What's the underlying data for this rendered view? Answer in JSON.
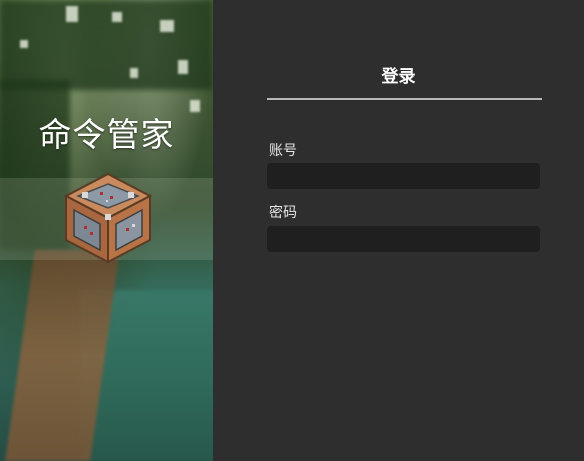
{
  "app": {
    "title": "命令管家"
  },
  "login": {
    "title": "登录",
    "username_label": "账号",
    "username_value": "",
    "password_label": "密码",
    "password_value": ""
  },
  "colors": {
    "panel_bg": "#2e2e2e",
    "input_bg": "#1f1f1f",
    "divider": "#b8b8b8",
    "text": "#ffffff"
  },
  "icons": {
    "logo": "command-block-icon"
  }
}
